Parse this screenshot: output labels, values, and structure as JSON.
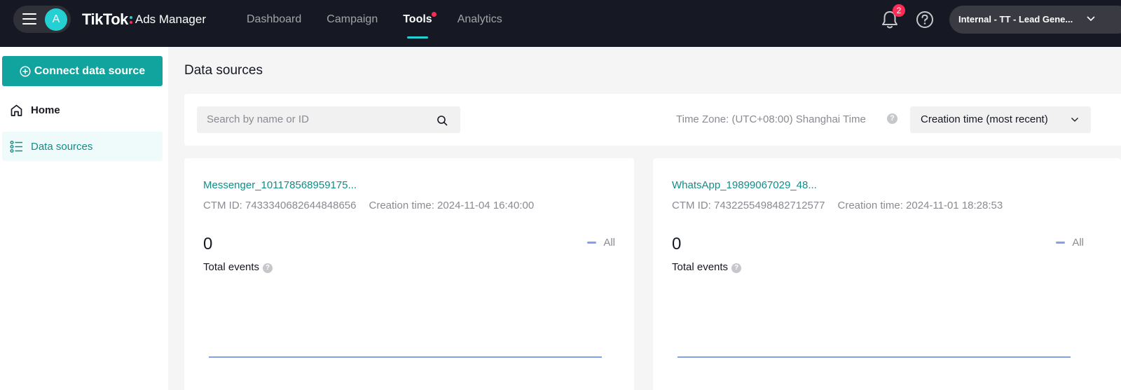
{
  "topbar": {
    "avatar_letter": "A",
    "brand": "TikTok",
    "product": "Ads Manager",
    "nav": [
      {
        "label": "Dashboard"
      },
      {
        "label": "Campaign"
      },
      {
        "label": "Tools"
      },
      {
        "label": "Analytics"
      }
    ],
    "active_nav": "Tools",
    "notification_count": "2",
    "account_name": "Internal - TT - Lead Gene..."
  },
  "sidebar": {
    "connect_label": "Connect data source",
    "items": [
      {
        "label": "Home"
      },
      {
        "label": "Data sources"
      }
    ]
  },
  "main": {
    "title": "Data sources",
    "search_placeholder": "Search by name or ID",
    "timezone": "Time Zone: (UTC+08:00) Shanghai Time",
    "sort_label": "Creation time (most recent)",
    "cards": [
      {
        "name": "Messenger_101178568959175...",
        "ctm_id": "CTM ID: 7433340682644848656",
        "creation": "Creation time: 2024-11-04 16:40:00",
        "value": "0",
        "label": "Total events",
        "legend": "All"
      },
      {
        "name": "WhatsApp_19899067029_48...",
        "ctm_id": "CTM ID: 7432255498482712577",
        "creation": "Creation time: 2024-11-01 18:28:53",
        "value": "0",
        "label": "Total events",
        "legend": "All"
      }
    ]
  },
  "colors": {
    "accent": "#11a39d",
    "accent_text": "#118d87",
    "topbar": "#161823",
    "chart_line": "#82a0ea",
    "notify_red": "#fe2c55"
  }
}
